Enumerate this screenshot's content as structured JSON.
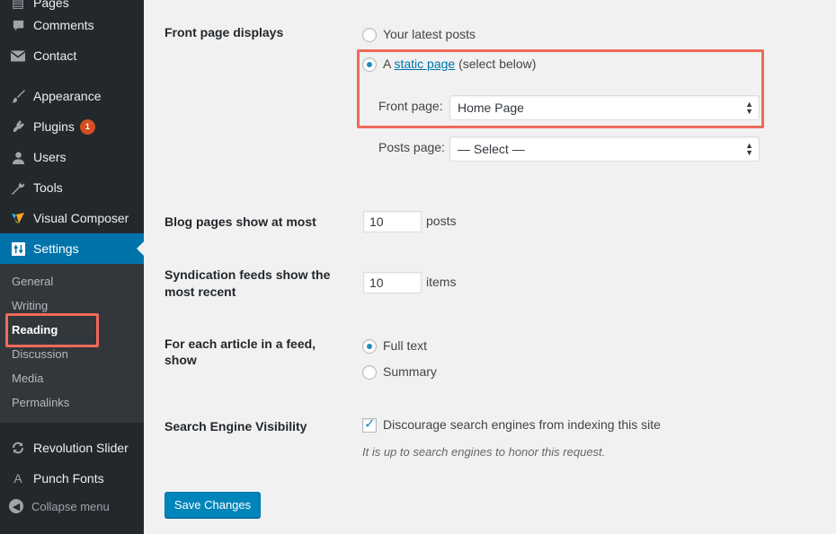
{
  "sidebar": {
    "items": [
      {
        "label": "Pages",
        "icon": "pages-icon"
      },
      {
        "label": "Comments",
        "icon": "comments-icon"
      },
      {
        "label": "Contact",
        "icon": "envelope-icon"
      },
      {
        "label": "Appearance",
        "icon": "paintbrush-icon"
      },
      {
        "label": "Plugins",
        "icon": "plugin-icon",
        "badge": "1"
      },
      {
        "label": "Users",
        "icon": "user-icon"
      },
      {
        "label": "Tools",
        "icon": "wrench-icon"
      },
      {
        "label": "Visual Composer",
        "icon": "visual-composer-icon"
      },
      {
        "label": "Settings",
        "icon": "settings-icon"
      },
      {
        "label": "Revolution Slider",
        "icon": "refresh-icon"
      },
      {
        "label": "Punch Fonts",
        "icon": "font-icon"
      }
    ],
    "submenu": [
      "General",
      "Writing",
      "Reading",
      "Discussion",
      "Media",
      "Permalinks"
    ],
    "current_submenu": "Reading",
    "collapse_label": "Collapse menu"
  },
  "form": {
    "front_page_displays": {
      "label": "Front page displays",
      "option_latest": "Your latest posts",
      "option_static_prefix": "A",
      "option_static_link": "static page",
      "option_static_suffix": "(select below)",
      "selected": "static",
      "front_page_label": "Front page:",
      "front_page_value": "Home Page",
      "posts_page_label": "Posts page:",
      "posts_page_value": "— Select —"
    },
    "blog_pages": {
      "label": "Blog pages show at most",
      "value": "10",
      "unit": "posts"
    },
    "syndication": {
      "label_line1": "Syndication feeds show the",
      "label_line2": "most recent",
      "value": "10",
      "unit": "items"
    },
    "feed_article": {
      "label_line1": "For each article in a feed,",
      "label_line2": "show",
      "option_full": "Full text",
      "option_summary": "Summary",
      "selected": "full"
    },
    "search_visibility": {
      "label": "Search Engine Visibility",
      "checkbox_label": "Discourage search engines from indexing this site",
      "checked": true,
      "description": "It is up to search engines to honor this request."
    },
    "save_label": "Save Changes"
  },
  "colors": {
    "sidebar_bg": "#23282d",
    "accent": "#0073aa",
    "highlight": "#ef6a5a",
    "badge": "#d54e21"
  }
}
